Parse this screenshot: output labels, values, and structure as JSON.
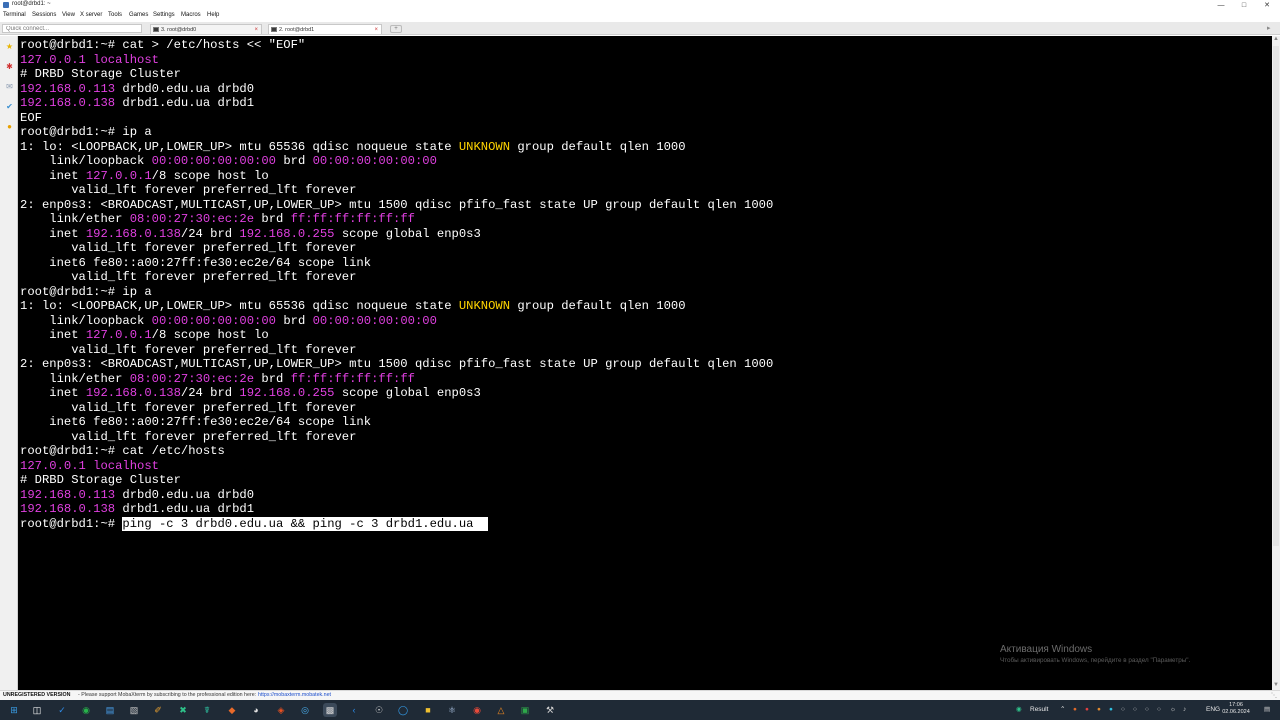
{
  "window": {
    "title": "root@drbd1: ~"
  },
  "menu": [
    "Terminal",
    "Sessions",
    "View",
    "X server",
    "Tools",
    "Games",
    "Settings",
    "Macros",
    "Help"
  ],
  "quick_connect": {
    "placeholder": "Quick connect..."
  },
  "tabs": [
    {
      "label": "3. root@drbd0"
    },
    {
      "label": "2. root@drbd1"
    }
  ],
  "terminal": {
    "lines": [
      [
        {
          "t": "root@drbd1:~# cat > /etc/hosts << \"EOF\""
        }
      ],
      [
        {
          "t": "127.0.0.1",
          "c": "m"
        },
        {
          "t": " localhost",
          "c": "m"
        }
      ],
      [
        {
          "t": "# DRBD Storage Cluster"
        }
      ],
      [
        {
          "t": "192.168.0.113",
          "c": "m"
        },
        {
          "t": " drbd0.edu.ua drbd0"
        }
      ],
      [
        {
          "t": "192.168.0.138",
          "c": "m"
        },
        {
          "t": " drbd1.edu.ua drbd1"
        }
      ],
      [
        {
          "t": "EOF"
        }
      ],
      [
        {
          "t": "root@drbd1:~# ip a"
        }
      ],
      [
        {
          "t": "1: lo: <LOOPBACK,UP,LOWER_UP> mtu 65536 qdisc noqueue state "
        },
        {
          "t": "UNKNOWN",
          "c": "y"
        },
        {
          "t": " group default qlen 1000"
        }
      ],
      [
        {
          "t": "    link/loopback "
        },
        {
          "t": "00:00:00:00:00:00",
          "c": "m"
        },
        {
          "t": " brd "
        },
        {
          "t": "00:00:00:00:00:00",
          "c": "m"
        }
      ],
      [
        {
          "t": "    inet "
        },
        {
          "t": "127.0.0.1",
          "c": "m"
        },
        {
          "t": "/8 scope host lo"
        }
      ],
      [
        {
          "t": "       valid_lft forever preferred_lft forever"
        }
      ],
      [
        {
          "t": "2: enp0s3: <BROADCAST,MULTICAST,UP,LOWER_UP> mtu 1500 qdisc pfifo_fast state UP group default qlen 1000"
        }
      ],
      [
        {
          "t": "    link/ether "
        },
        {
          "t": "08:00:27:30:ec:2e",
          "c": "m"
        },
        {
          "t": " brd "
        },
        {
          "t": "ff:ff:ff:ff:ff:ff",
          "c": "m"
        }
      ],
      [
        {
          "t": "    inet "
        },
        {
          "t": "192.168.0.138",
          "c": "m"
        },
        {
          "t": "/24 brd "
        },
        {
          "t": "192.168.0.255",
          "c": "m"
        },
        {
          "t": " scope global enp0s3"
        }
      ],
      [
        {
          "t": "       valid_lft forever preferred_lft forever"
        }
      ],
      [
        {
          "t": "    inet6 fe80::a00:27ff:fe30:ec2e/64 scope link"
        }
      ],
      [
        {
          "t": "       valid_lft forever preferred_lft forever"
        }
      ],
      [
        {
          "t": "root@drbd1:~# ip a"
        }
      ],
      [
        {
          "t": "1: lo: <LOOPBACK,UP,LOWER_UP> mtu 65536 qdisc noqueue state "
        },
        {
          "t": "UNKNOWN",
          "c": "y"
        },
        {
          "t": " group default qlen 1000"
        }
      ],
      [
        {
          "t": "    link/loopback "
        },
        {
          "t": "00:00:00:00:00:00",
          "c": "m"
        },
        {
          "t": " brd "
        },
        {
          "t": "00:00:00:00:00:00",
          "c": "m"
        }
      ],
      [
        {
          "t": "    inet "
        },
        {
          "t": "127.0.0.1",
          "c": "m"
        },
        {
          "t": "/8 scope host lo"
        }
      ],
      [
        {
          "t": "       valid_lft forever preferred_lft forever"
        }
      ],
      [
        {
          "t": "2: enp0s3: <BROADCAST,MULTICAST,UP,LOWER_UP> mtu 1500 qdisc pfifo_fast state UP group default qlen 1000"
        }
      ],
      [
        {
          "t": "    link/ether "
        },
        {
          "t": "08:00:27:30:ec:2e",
          "c": "m"
        },
        {
          "t": " brd "
        },
        {
          "t": "ff:ff:ff:ff:ff:ff",
          "c": "m"
        }
      ],
      [
        {
          "t": "    inet "
        },
        {
          "t": "192.168.0.138",
          "c": "m"
        },
        {
          "t": "/24 brd "
        },
        {
          "t": "192.168.0.255",
          "c": "m"
        },
        {
          "t": " scope global enp0s3"
        }
      ],
      [
        {
          "t": "       valid_lft forever preferred_lft forever"
        }
      ],
      [
        {
          "t": "    inet6 fe80::a00:27ff:fe30:ec2e/64 scope link"
        }
      ],
      [
        {
          "t": "       valid_lft forever preferred_lft forever"
        }
      ],
      [
        {
          "t": "root@drbd1:~# cat /etc/hosts"
        }
      ],
      [
        {
          "t": "127.0.0.1",
          "c": "m"
        },
        {
          "t": " localhost",
          "c": "m"
        }
      ],
      [
        {
          "t": "# DRBD Storage Cluster"
        }
      ],
      [
        {
          "t": "192.168.0.113",
          "c": "m"
        },
        {
          "t": " drbd0.edu.ua drbd0"
        }
      ],
      [
        {
          "t": "192.168.0.138",
          "c": "m"
        },
        {
          "t": " drbd1.edu.ua drbd1"
        }
      ],
      [
        {
          "t": "root@drbd1:~# "
        },
        {
          "t": "ping -c 3 drbd0.edu.ua && ping -c 3 drbd1.edu.ua  ",
          "c": "sel"
        }
      ]
    ]
  },
  "watermark": {
    "title": "Активация Windows",
    "subtitle": "Чтобы активировать Windows, перейдите в раздел \"Параметры\"."
  },
  "statusbar": {
    "unregistered": "UNREGISTERED VERSION",
    "message": "  -  Please support MobaXterm by subscribing to the professional edition here:",
    "link": "https://mobaxterm.mobatek.net"
  },
  "taskbar": {
    "tray_result": "Result",
    "lang": "ENG",
    "time": "17:06",
    "date": "02.06.2024"
  },
  "colors": {
    "magenta": "#e040e0",
    "yellow": "#ffd400",
    "terminal_bg": "#000000",
    "taskbar_bg": "#1f2a36"
  }
}
